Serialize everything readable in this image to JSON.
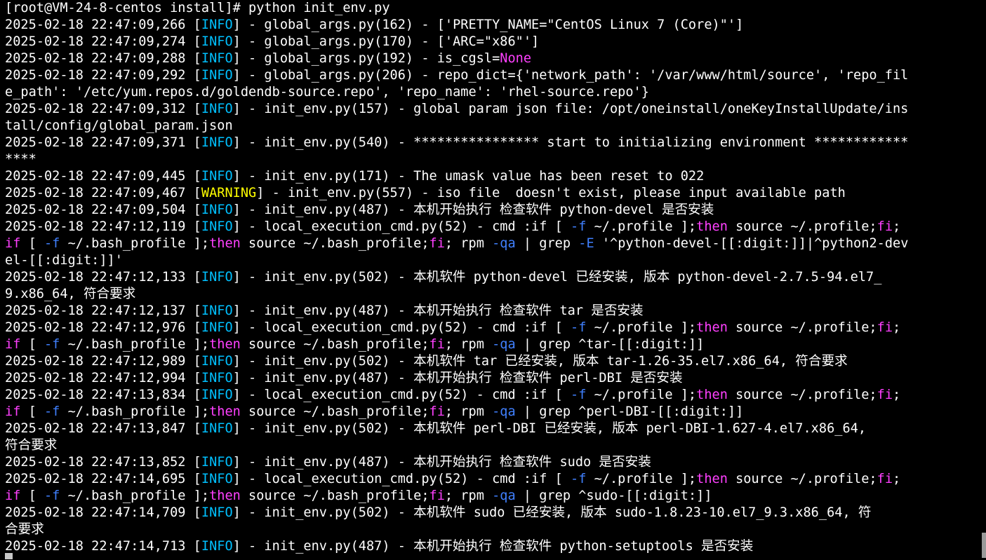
{
  "colors": {
    "background": "#000000",
    "default": "#ffffff",
    "info": "#00c0ff",
    "warning": "#ffff00",
    "keyword": "#ff40ff",
    "option": "#4080ff",
    "none": "#ff40ff"
  },
  "lines": [
    [
      [
        "default",
        "[root@VM-24-8-centos install]# python init_env.py"
      ]
    ],
    [
      [
        "default",
        "2025-02-18 22:47:09,266 ["
      ],
      [
        "info",
        "INFO"
      ],
      [
        "default",
        "] - global_args.py(162) - ['PRETTY_NAME=\"CentOS Linux 7 (Core)\"']"
      ]
    ],
    [
      [
        "default",
        "2025-02-18 22:47:09,274 ["
      ],
      [
        "info",
        "INFO"
      ],
      [
        "default",
        "] - global_args.py(170) - ['ARC=\"x86\"']"
      ]
    ],
    [
      [
        "default",
        "2025-02-18 22:47:09,288 ["
      ],
      [
        "info",
        "INFO"
      ],
      [
        "default",
        "] - global_args.py(192) - is_cgsl="
      ],
      [
        "none",
        "None"
      ]
    ],
    [
      [
        "default",
        "2025-02-18 22:47:09,292 ["
      ],
      [
        "info",
        "INFO"
      ],
      [
        "default",
        "] - global_args.py(206) - repo_dict={'network_path': '/var/www/html/source', 'repo_fil"
      ]
    ],
    [
      [
        "default",
        "e_path': '/etc/yum.repos.d/goldendb-source.repo', 'repo_name': 'rhel-source.repo'}"
      ]
    ],
    [
      [
        "default",
        "2025-02-18 22:47:09,312 ["
      ],
      [
        "info",
        "INFO"
      ],
      [
        "default",
        "] - init_env.py(157) - global param json file: /opt/oneinstall/oneKeyInstallUpdate/ins"
      ]
    ],
    [
      [
        "default",
        "tall/config/global_param.json"
      ]
    ],
    [
      [
        "default",
        "2025-02-18 22:47:09,371 ["
      ],
      [
        "info",
        "INFO"
      ],
      [
        "default",
        "] - init_env.py(540) - **************** start to initializing environment ************"
      ]
    ],
    [
      [
        "default",
        "****"
      ]
    ],
    [
      [
        "default",
        "2025-02-18 22:47:09,445 ["
      ],
      [
        "info",
        "INFO"
      ],
      [
        "default",
        "] - init_env.py(171) - The umask value has been reset to 022"
      ]
    ],
    [
      [
        "default",
        "2025-02-18 22:47:09,467 ["
      ],
      [
        "warning",
        "WARNING"
      ],
      [
        "default",
        "] - init_env.py(557) - iso file  doesn't exist, please input available path"
      ]
    ],
    [
      [
        "default",
        "2025-02-18 22:47:09,504 ["
      ],
      [
        "info",
        "INFO"
      ],
      [
        "default",
        "] - init_env.py(487) - 本机开始执行 检查软件 python-devel 是否安装"
      ]
    ],
    [
      [
        "default",
        "2025-02-18 22:47:12,119 ["
      ],
      [
        "info",
        "INFO"
      ],
      [
        "default",
        "] - local_execution_cmd.py(52) - cmd :if [ "
      ],
      [
        "option",
        "-f"
      ],
      [
        "default",
        " ~/.profile ];"
      ],
      [
        "keyword",
        "then"
      ],
      [
        "default",
        " source ~/.profile;"
      ],
      [
        "keyword",
        "fi"
      ],
      [
        "default",
        ";"
      ]
    ],
    [
      [
        "keyword",
        "if"
      ],
      [
        "default",
        " [ "
      ],
      [
        "option",
        "-f"
      ],
      [
        "default",
        " ~/.bash_profile ];"
      ],
      [
        "keyword",
        "then"
      ],
      [
        "default",
        " source ~/.bash_profile;"
      ],
      [
        "keyword",
        "fi"
      ],
      [
        "default",
        "; rpm "
      ],
      [
        "option",
        "-qa"
      ],
      [
        "default",
        " | grep "
      ],
      [
        "option",
        "-E"
      ],
      [
        "default",
        " '^python-devel-[[:digit:]]|^python2-dev"
      ]
    ],
    [
      [
        "default",
        "el-[[:digit:]]'"
      ]
    ],
    [
      [
        "default",
        "2025-02-18 22:47:12,133 ["
      ],
      [
        "info",
        "INFO"
      ],
      [
        "default",
        "] - init_env.py(502) - 本机软件 python-devel 已经安装, 版本 python-devel-2.7.5-94.el7_"
      ]
    ],
    [
      [
        "default",
        "9.x86_64, 符合要求"
      ]
    ],
    [
      [
        "default",
        "2025-02-18 22:47:12,137 ["
      ],
      [
        "info",
        "INFO"
      ],
      [
        "default",
        "] - init_env.py(487) - 本机开始执行 检查软件 tar 是否安装"
      ]
    ],
    [
      [
        "default",
        "2025-02-18 22:47:12,976 ["
      ],
      [
        "info",
        "INFO"
      ],
      [
        "default",
        "] - local_execution_cmd.py(52) - cmd :if [ "
      ],
      [
        "option",
        "-f"
      ],
      [
        "default",
        " ~/.profile ];"
      ],
      [
        "keyword",
        "then"
      ],
      [
        "default",
        " source ~/.profile;"
      ],
      [
        "keyword",
        "fi"
      ],
      [
        "default",
        ";"
      ]
    ],
    [
      [
        "keyword",
        "if"
      ],
      [
        "default",
        " [ "
      ],
      [
        "option",
        "-f"
      ],
      [
        "default",
        " ~/.bash_profile ];"
      ],
      [
        "keyword",
        "then"
      ],
      [
        "default",
        " source ~/.bash_profile;"
      ],
      [
        "keyword",
        "fi"
      ],
      [
        "default",
        "; rpm "
      ],
      [
        "option",
        "-qa"
      ],
      [
        "default",
        " | grep ^tar-[[:digit:]]"
      ]
    ],
    [
      [
        "default",
        "2025-02-18 22:47:12,989 ["
      ],
      [
        "info",
        "INFO"
      ],
      [
        "default",
        "] - init_env.py(502) - 本机软件 tar 已经安装, 版本 tar-1.26-35.el7.x86_64, 符合要求"
      ]
    ],
    [
      [
        "default",
        "2025-02-18 22:47:12,994 ["
      ],
      [
        "info",
        "INFO"
      ],
      [
        "default",
        "] - init_env.py(487) - 本机开始执行 检查软件 perl-DBI 是否安装"
      ]
    ],
    [
      [
        "default",
        "2025-02-18 22:47:13,834 ["
      ],
      [
        "info",
        "INFO"
      ],
      [
        "default",
        "] - local_execution_cmd.py(52) - cmd :if [ "
      ],
      [
        "option",
        "-f"
      ],
      [
        "default",
        " ~/.profile ];"
      ],
      [
        "keyword",
        "then"
      ],
      [
        "default",
        " source ~/.profile;"
      ],
      [
        "keyword",
        "fi"
      ],
      [
        "default",
        ";"
      ]
    ],
    [
      [
        "keyword",
        "if"
      ],
      [
        "default",
        " [ "
      ],
      [
        "option",
        "-f"
      ],
      [
        "default",
        " ~/.bash_profile ];"
      ],
      [
        "keyword",
        "then"
      ],
      [
        "default",
        " source ~/.bash_profile;"
      ],
      [
        "keyword",
        "fi"
      ],
      [
        "default",
        "; rpm "
      ],
      [
        "option",
        "-qa"
      ],
      [
        "default",
        " | grep ^perl-DBI-[[:digit:]]"
      ]
    ],
    [
      [
        "default",
        "2025-02-18 22:47:13,847 ["
      ],
      [
        "info",
        "INFO"
      ],
      [
        "default",
        "] - init_env.py(502) - 本机软件 perl-DBI 已经安装, 版本 perl-DBI-1.627-4.el7.x86_64,"
      ]
    ],
    [
      [
        "default",
        "符合要求"
      ]
    ],
    [
      [
        "default",
        "2025-02-18 22:47:13,852 ["
      ],
      [
        "info",
        "INFO"
      ],
      [
        "default",
        "] - init_env.py(487) - 本机开始执行 检查软件 sudo 是否安装"
      ]
    ],
    [
      [
        "default",
        "2025-02-18 22:47:14,695 ["
      ],
      [
        "info",
        "INFO"
      ],
      [
        "default",
        "] - local_execution_cmd.py(52) - cmd :if [ "
      ],
      [
        "option",
        "-f"
      ],
      [
        "default",
        " ~/.profile ];"
      ],
      [
        "keyword",
        "then"
      ],
      [
        "default",
        " source ~/.profile;"
      ],
      [
        "keyword",
        "fi"
      ],
      [
        "default",
        ";"
      ]
    ],
    [
      [
        "keyword",
        "if"
      ],
      [
        "default",
        " [ "
      ],
      [
        "option",
        "-f"
      ],
      [
        "default",
        " ~/.bash_profile ];"
      ],
      [
        "keyword",
        "then"
      ],
      [
        "default",
        " source ~/.bash_profile;"
      ],
      [
        "keyword",
        "fi"
      ],
      [
        "default",
        "; rpm "
      ],
      [
        "option",
        "-qa"
      ],
      [
        "default",
        " | grep ^sudo-[[:digit:]]"
      ]
    ],
    [
      [
        "default",
        "2025-02-18 22:47:14,709 ["
      ],
      [
        "info",
        "INFO"
      ],
      [
        "default",
        "] - init_env.py(502) - 本机软件 sudo 已经安装, 版本 sudo-1.8.23-10.el7_9.3.x86_64, 符"
      ]
    ],
    [
      [
        "default",
        "合要求"
      ]
    ],
    [
      [
        "default",
        "2025-02-18 22:47:14,713 ["
      ],
      [
        "info",
        "INFO"
      ],
      [
        "default",
        "] - init_env.py(487) - 本机开始执行 检查软件 python-setuptools 是否安装"
      ]
    ]
  ]
}
